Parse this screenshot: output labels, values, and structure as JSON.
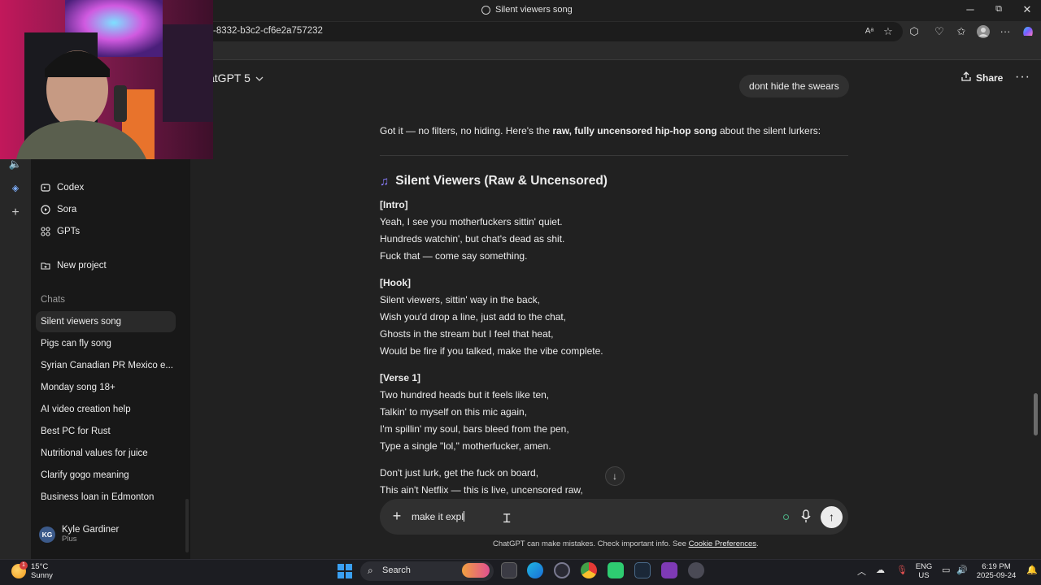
{
  "browser": {
    "window_title": "Silent viewers song",
    "url": "-8332-b3c2-cf6e2a757232",
    "controls": {
      "minimize": "─",
      "maximize": "⧉",
      "close": "✕"
    }
  },
  "header": {
    "model_label": "atGPT 5",
    "share_label": "Share",
    "more_label": "···"
  },
  "sidebar": {
    "nav": [
      {
        "label": "Codex",
        "icon": "codex-icon"
      },
      {
        "label": "Sora",
        "icon": "sora-icon"
      },
      {
        "label": "GPTs",
        "icon": "gpts-icon"
      },
      {
        "label": "New project",
        "icon": "new-project-icon"
      }
    ],
    "chats_heading": "Chats",
    "chats": [
      "Silent viewers song",
      "Pigs can fly song",
      "Syrian Canadian PR Mexico e...",
      "Monday song 18+",
      "AI video creation help",
      "Best PC for Rust",
      "Nutritional values for juice",
      "Clarify gogo meaning",
      "Business loan in Edmonton"
    ],
    "user": {
      "initials": "KG",
      "name": "Kyle Gardiner",
      "plan": "Plus"
    }
  },
  "conversation": {
    "user_message": "dont hide the swears",
    "intro_pre": "Got it — no filters, no hiding. Here's the ",
    "intro_bold": "raw, fully uncensored hip-hop song",
    "intro_post": " about the silent lurkers:",
    "song_title": "Silent Viewers (Raw & Uncensored)",
    "sections": [
      {
        "heading": "[Intro]",
        "lines": [
          "Yeah, I see you motherfuckers sittin' quiet.",
          "Hundreds watchin', but chat's dead as shit.",
          "Fuck that — come say something."
        ]
      },
      {
        "heading": "[Hook]",
        "lines": [
          "Silent viewers, sittin' way in the back,",
          "Wish you'd drop a line, just add to the chat,",
          "Ghosts in the stream but I feel that heat,",
          "Would be fire if you talked, make the vibe complete."
        ]
      },
      {
        "heading": "[Verse 1]",
        "lines": [
          "Two hundred heads but it feels like ten,",
          "Talkin' to myself on this mic again,",
          "I'm spillin' my soul, bars bleed from the pen,",
          "Type a single \"lol,\" motherfucker, amen."
        ]
      },
      {
        "heading": "",
        "lines": [
          "Don't just lurk, get the fuck on board,",
          "This ain't Netflix — this is live, uncensored raw,"
        ]
      }
    ]
  },
  "composer": {
    "plus_label": "+",
    "input_value": "make it expl",
    "send_label": "↑",
    "scroll_down_label": "↓"
  },
  "disclaimer": {
    "text": "ChatGPT can make mistakes. Check important info. See ",
    "link": "Cookie Preferences",
    "end": "."
  },
  "taskbar": {
    "weather_temp": "15°C",
    "weather_desc": "Sunny",
    "weather_badge": "1",
    "search_label": "Search",
    "lang_top": "ENG",
    "lang_bottom": "US",
    "time": "6:19 PM",
    "date": "2025-09-24"
  },
  "colors": {
    "background": "#212121",
    "sidebar": "#181818",
    "bubble": "#303030",
    "accent_note": "#8a7dff"
  }
}
